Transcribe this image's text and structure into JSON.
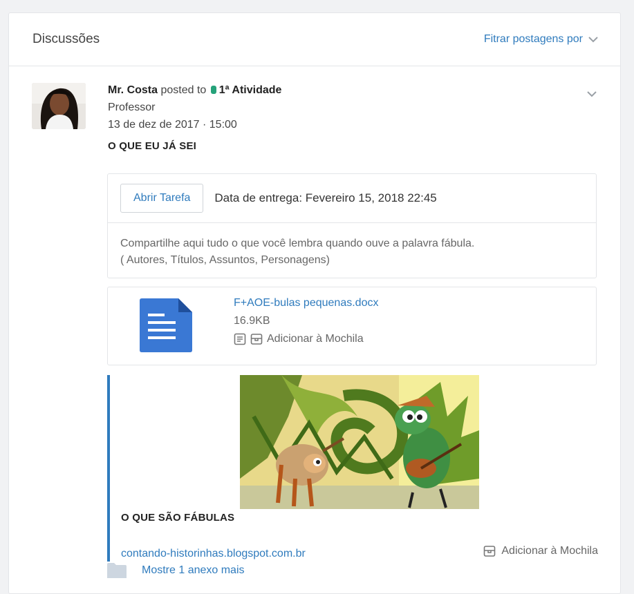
{
  "header": {
    "title": "Discussões",
    "filter_label": "Fitrar postagens por"
  },
  "post": {
    "author": "Mr. Costa",
    "posted_to_text": " posted to ",
    "channel": "1ª Atividade",
    "role": "Professor",
    "timestamp": "13 de dez de 2017 · 15:00",
    "heading": "O QUE EU JÁ SEI",
    "task": {
      "open_button": "Abrir Tarefa",
      "due_text": "Data de entrega: Fevereiro 15, 2018 22:45",
      "description_line1": "Compartilhe aqui tudo o que você lembra quando ouve a palavra fábula.",
      "description_line2": "( Autores, Títulos, Assuntos, Personagens)"
    },
    "attachment": {
      "file_name": "F+AOE-bulas pequenas.docx",
      "file_size": "16.9KB",
      "add_label": "Adicionar à Mochila"
    },
    "link": {
      "title": "O QUE SÃO FÁBULAS",
      "url": "contando-historinhas.blogspot.com.br",
      "add_label": "Adicionar à Mochila"
    },
    "more_attachments": "Mostre 1 anexo mais"
  },
  "colors": {
    "link": "#2f7bbd",
    "channel_tag": "#25a27a",
    "doc_icon": "#3a78d4"
  },
  "icons": [
    "chevron-down-icon",
    "doc-icon",
    "notes-icon",
    "backpack-icon",
    "folder-icon"
  ]
}
